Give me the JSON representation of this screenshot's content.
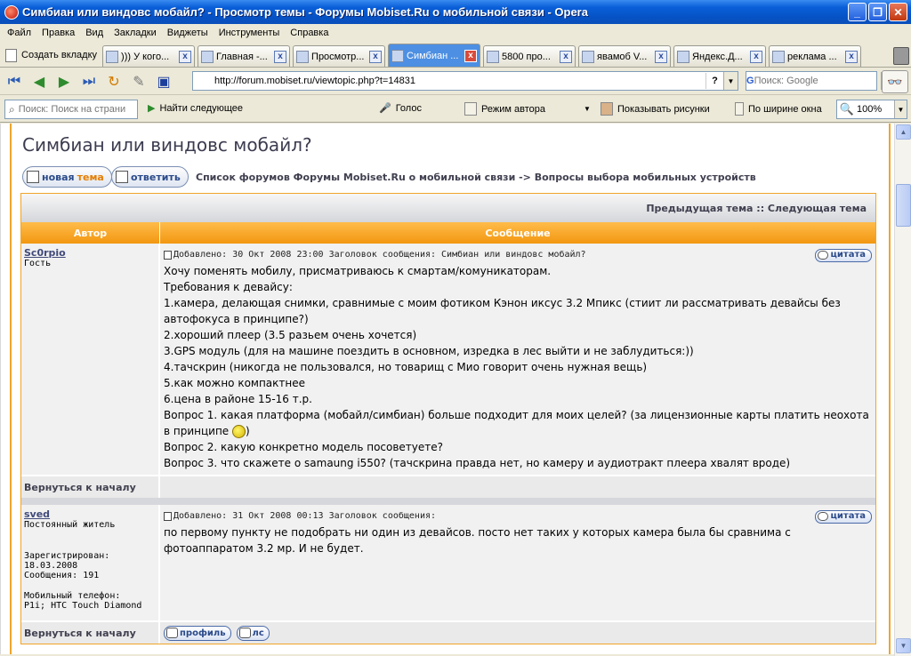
{
  "window": {
    "title": "Симбиан или виндовс мобайл? - Просмотр темы - Форумы Mobiset.Ru о мобильной связи - Opera"
  },
  "menu": [
    "Файл",
    "Правка",
    "Вид",
    "Закладки",
    "Виджеты",
    "Инструменты",
    "Справка"
  ],
  "tabs": {
    "new_tab": "Создать вкладку",
    "items": [
      {
        "label": "))) У кого..."
      },
      {
        "label": "Главная -..."
      },
      {
        "label": "Просмотр..."
      },
      {
        "label": "Симбиан ..."
      },
      {
        "label": "5800 про..."
      },
      {
        "label": "явамоб V..."
      },
      {
        "label": "Яндекс.Д..."
      },
      {
        "label": "реклама ..."
      }
    ]
  },
  "address": {
    "url": "http://forum.mobiset.ru/viewtopic.php?t=14831",
    "search_placeholder": "Поиск: Google",
    "search_engine_letter": "G"
  },
  "findbar": {
    "placeholder": "Поиск: Поиск на страни",
    "find_next": "Найти следующее",
    "voice": "Голос",
    "author_mode": "Режим автора",
    "show_images": "Показывать рисунки",
    "fit_width": "По ширине окна",
    "zoom": "100%"
  },
  "page": {
    "topic_title": "Симбиан или виндовс мобайл?",
    "new_topic_a": "новая",
    "new_topic_b": "тема",
    "reply": "ответить",
    "breadcrumb": "Список форумов Форумы Mobiset.Ru о мобильной связи -> Вопросы выбора мобильных устройств",
    "prev_next": "Предыдущая тема :: Следующая тема",
    "col_author": "Автор",
    "col_message": "Сообщение",
    "back_to_top": "Вернуться к началу",
    "quote": "цитата",
    "profile": "профиль",
    "pm": "лс",
    "posts": [
      {
        "author": "Sc0rpio",
        "rank": "Гость",
        "meta": "Добавлено: 30 Окт 2008 23:00   Заголовок сообщения: Симбиан или виндовс мобайл?",
        "lines": [
          "Хочу поменять мобилу, присматриваюсь к смартам/комуникаторам.",
          "Требования к девайсу:",
          "1.камера, делающая снимки, сравнимые с моим фотиком Кэнон иксус 3.2 Мпикс (стиит ли рассматривать девайсы без автофокуса в принципе?)",
          "2.хороший плеер (3.5 разьем очень хочется)",
          "3.GPS модуль (для на машине поездить в основном, изредка в лес выйти и не заблудиться:))",
          "4.тачскрин (никогда не пользовался, но товарищ с Мио говорит очень нужная вещь)",
          "5.как можно компактнее",
          "6.цена в районе 15-16 т.р.",
          "Вопрос 1. какая платформа (мобайл/симбиан) больше подходит для моих целей? (за лицензионные карты платить неохота в принципе",
          "Вопрос 2. какую конкретно модель посоветуете?",
          "Вопрос 3. что скажете о samaung i550? (тачскрина правда нет, но камеру и аудиотракт плеера хвалят вроде)"
        ],
        "line9_tail": ")"
      },
      {
        "author": "sved",
        "rank": "Постоянный житель",
        "registered_label": "Зарегистрирован:",
        "registered_date": "18.03.2008",
        "posts_count": "Сообщения: 191",
        "phone_label": "Мобильный телефон:",
        "phone": "P1i; HTC Touch Diamond",
        "meta": "Добавлено: 31 Окт 2008 00:13   Заголовок сообщения:",
        "text": "по первому пункту не подобрать ни один из девайсов. посто нет таких у которых камера была бы сравнима с фотоаппаратом 3.2 мр. И не будет."
      }
    ]
  }
}
